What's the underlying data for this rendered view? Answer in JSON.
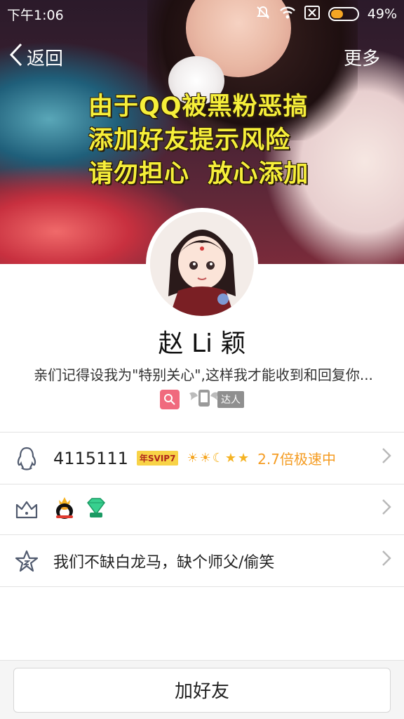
{
  "status_bar": {
    "time": "下午1:06",
    "battery": "49%",
    "battery_level": 0.49
  },
  "nav": {
    "back_label": "返回",
    "more_label": "更多"
  },
  "cover": {
    "text": "由于QQ被黑粉恶搞\n添加好友提示风险\n请勿担心  放心添加"
  },
  "profile": {
    "name": "赵 Li 颖",
    "signature": "亲们记得设我为\"特别关心\",这样我才能收到和回复你...",
    "tag_daren": "达人"
  },
  "rows": {
    "qq": {
      "number": "4115111",
      "svip_badge": "年SVIP7",
      "speed_text": "2.7倍极速中"
    },
    "status": "我们不缺白龙马，缺个师父/偷笑"
  },
  "bottom": {
    "add_friend_label": "加好友"
  },
  "colors": {
    "accent_orange": "#f59c22",
    "cover_text": "#f6ef3a",
    "tag_pink": "#f06a7e"
  },
  "icons": [
    "mute-icon",
    "wifi-icon",
    "no-sim-icon",
    "battery-icon",
    "back-chevron-icon",
    "qq-penguin-icon",
    "crown-icon",
    "star-icon",
    "chevron-right-icon"
  ]
}
